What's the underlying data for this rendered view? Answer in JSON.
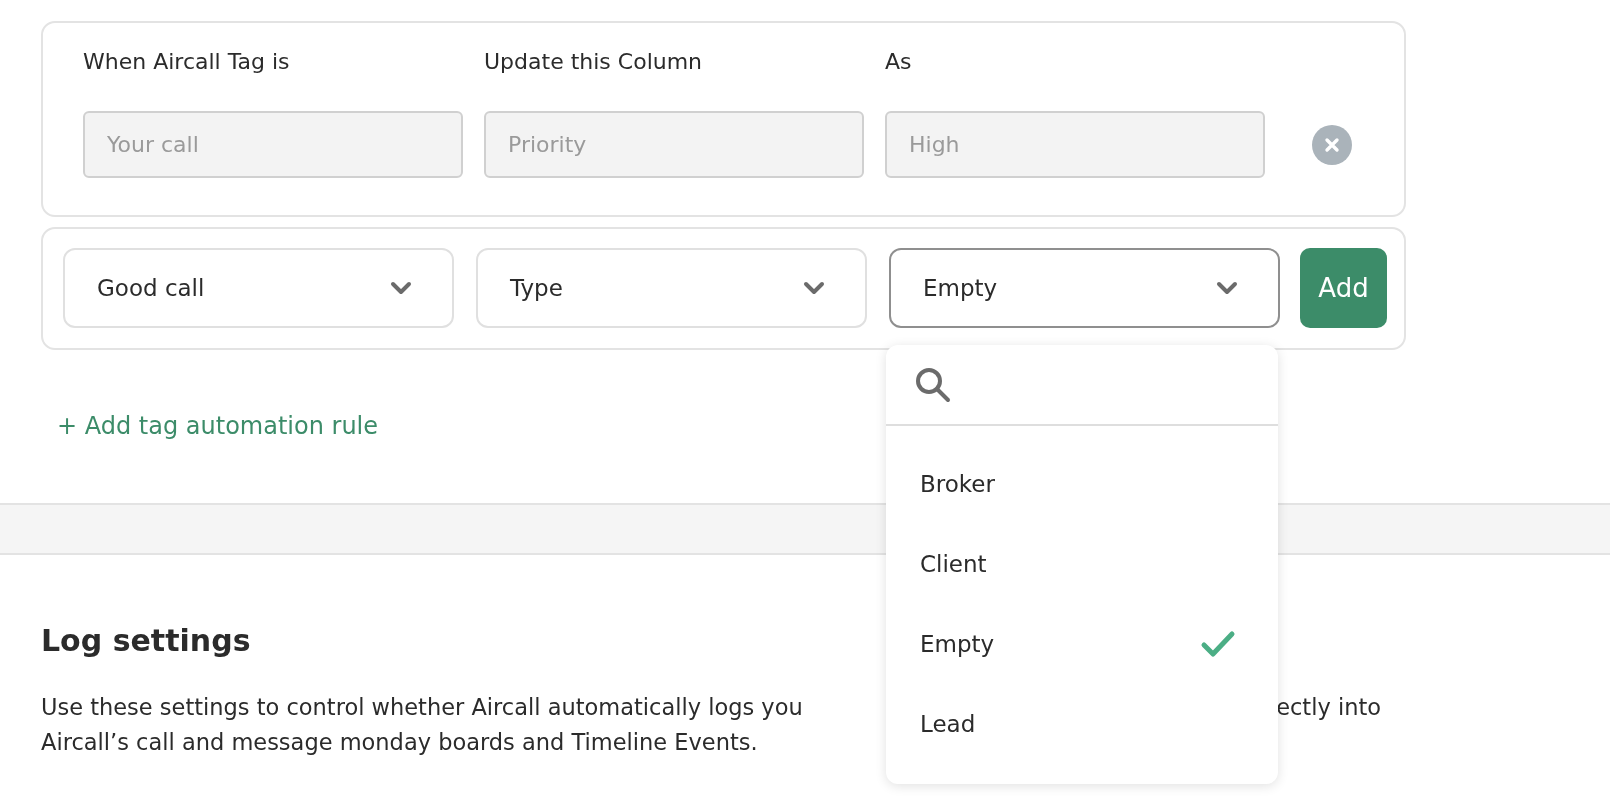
{
  "rule_header": {
    "columns": [
      "When Aircall Tag is",
      "Update this Column",
      "As"
    ],
    "fields": [
      {
        "value": "Your call",
        "disabled": true
      },
      {
        "value": "Priority",
        "disabled": true
      },
      {
        "value": "High",
        "disabled": true
      }
    ]
  },
  "rule_editor": {
    "selects": [
      {
        "value": "Good call",
        "focused": false
      },
      {
        "value": "Type",
        "focused": false
      },
      {
        "value": "Empty",
        "focused": true
      }
    ],
    "add_button": "Add"
  },
  "dropdown": {
    "options": [
      {
        "label": "Broker",
        "selected": false
      },
      {
        "label": "Client",
        "selected": false
      },
      {
        "label": "Empty",
        "selected": true
      },
      {
        "label": "Lead",
        "selected": false
      }
    ]
  },
  "add_rule_link": "+ Add tag automation rule",
  "log_settings": {
    "title": "Log settings",
    "description_lines": [
      [
        "Use these settings to control whether Aircall automatically logs you",
        "ectly into"
      ],
      [
        "Aircall’s call and message monday boards and Timeline Events."
      ]
    ]
  }
}
